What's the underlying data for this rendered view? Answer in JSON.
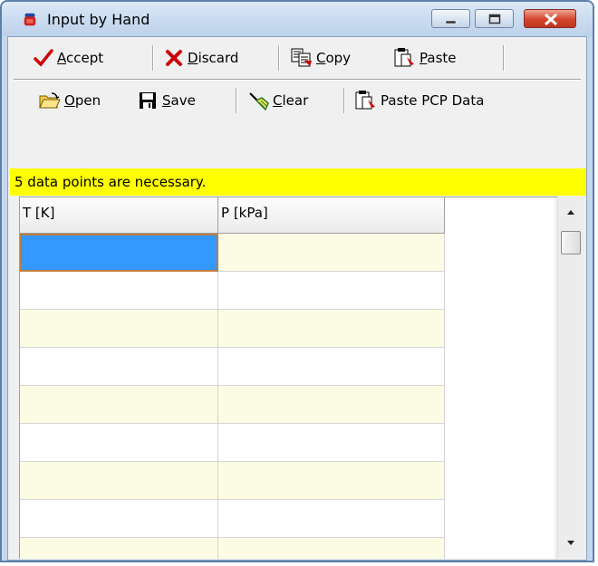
{
  "window": {
    "title": "Input by Hand",
    "controls": {
      "minimize": "minimize",
      "maximize": "maximize",
      "close": "close"
    }
  },
  "toolbar1": [
    {
      "id": "accept",
      "label_pre": "",
      "accel": "A",
      "label_post": "ccept",
      "icon": "checkmark-icon",
      "color": "#cc0000"
    },
    {
      "id": "discard",
      "label_pre": "",
      "accel": "D",
      "label_post": "iscard",
      "icon": "x-icon",
      "color": "#cc0000"
    },
    {
      "id": "copy",
      "label_pre": "",
      "accel": "C",
      "label_post": "opy",
      "icon": "copy-icon"
    },
    {
      "id": "paste",
      "label_pre": "",
      "accel": "P",
      "label_post": "aste",
      "icon": "paste-icon"
    }
  ],
  "toolbar2": [
    {
      "id": "open",
      "label_pre": "",
      "accel": "O",
      "label_post": "pen",
      "icon": "folder-open-icon"
    },
    {
      "id": "save",
      "label_pre": "",
      "accel": "S",
      "label_post": "ave",
      "icon": "floppy-disk-icon"
    },
    {
      "id": "clear",
      "label_pre": "",
      "accel": "C",
      "label_post": "lear",
      "icon": "broom-icon"
    },
    {
      "id": "paste_pcp",
      "label": "Paste PCP Data",
      "icon": "paste-icon"
    }
  ],
  "info": {
    "message": "5 data points are necessary.",
    "color": "#ffff00"
  },
  "grid": {
    "columns": [
      "T [K]",
      "P [kPa]"
    ],
    "rows": [
      [
        "",
        ""
      ],
      [
        "",
        ""
      ],
      [
        "",
        ""
      ],
      [
        "",
        ""
      ],
      [
        "",
        ""
      ],
      [
        "",
        ""
      ],
      [
        "",
        ""
      ],
      [
        "",
        ""
      ],
      [
        "",
        ""
      ]
    ],
    "selected_row": 0,
    "selected_col": 0,
    "colors": {
      "selected": "#3399ff",
      "odd_row": "#fcfbe3",
      "even_row": "#ffffff",
      "header": "#f0f0f0"
    }
  }
}
